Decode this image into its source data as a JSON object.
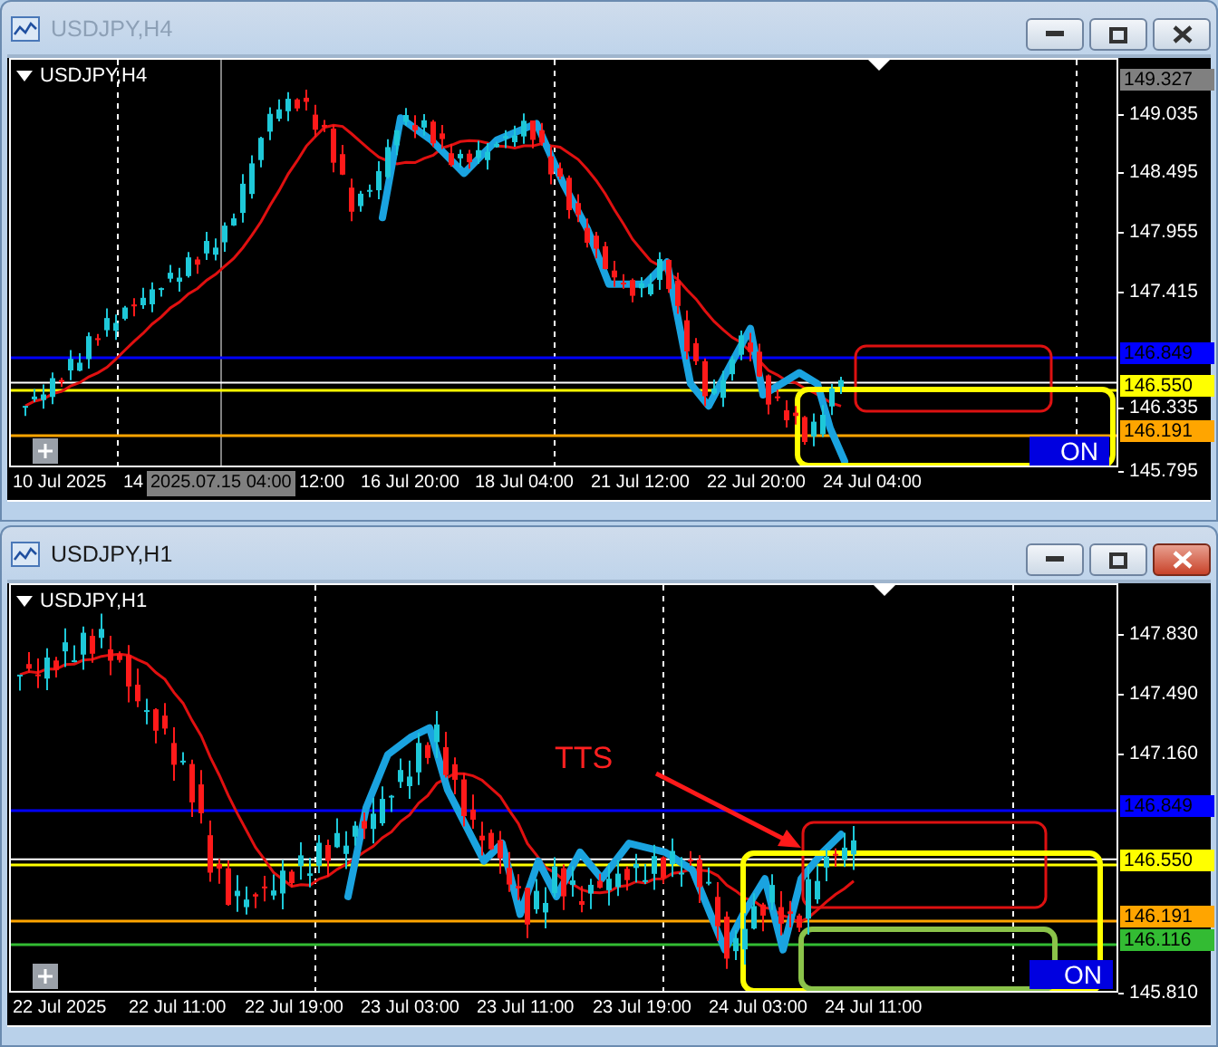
{
  "windows": [
    {
      "title": "USDJPY,H4",
      "active": false,
      "chart_label": "USDJPY,H4",
      "price_labels": [
        "149.035",
        "148.495",
        "147.955",
        "147.415",
        "146.335",
        "145.795"
      ],
      "price_tags": [
        {
          "text": "149.327",
          "color": "#808080"
        },
        {
          "text": "146.849",
          "color": "#0000ff"
        },
        {
          "text": "146.550",
          "color": "#ffff00"
        },
        {
          "text": "146.191",
          "color": "#ffa500"
        }
      ],
      "time_labels": [
        "10 Jul 2025",
        "14",
        "12:00",
        "16 Jul 20:00",
        "18 Jul 04:00",
        "21 Jul 12:00",
        "22 Jul 20:00",
        "24 Jul 04:00"
      ],
      "crosshair_time": "2025.07.15 04:00",
      "on_button": "ON"
    },
    {
      "title": "USDJPY,H1",
      "active": true,
      "chart_label": "USDJPY,H1",
      "price_labels": [
        "147.830",
        "147.490",
        "147.160",
        "145.810"
      ],
      "price_tags": [
        {
          "text": "146.849",
          "color": "#0000ff"
        },
        {
          "text": "146.550",
          "color": "#ffff00"
        },
        {
          "text": "146.191",
          "color": "#ffa500"
        },
        {
          "text": "146.116",
          "color": "#33bb33"
        }
      ],
      "time_labels": [
        "22 Jul 2025",
        "22 Jul 11:00",
        "22 Jul 19:00",
        "23 Jul 03:00",
        "23 Jul 11:00",
        "23 Jul 19:00",
        "24 Jul 03:00",
        "24 Jul 11:00"
      ],
      "on_button": "ON",
      "annotation": "TTS"
    }
  ]
}
